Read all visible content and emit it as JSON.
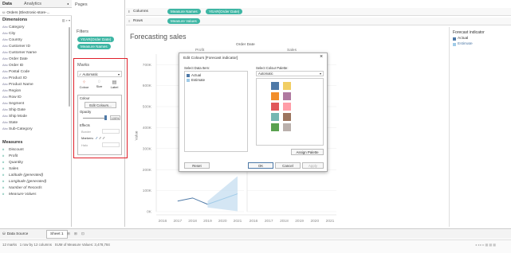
{
  "left_tabs": {
    "data": "Data",
    "analytics": "Analytics"
  },
  "datasource": "Orders (Electronic-store-...",
  "dimensions": {
    "title": "Dimensions",
    "fields": [
      "Category",
      "City",
      "Country",
      "Customer ID",
      "Customer Name",
      "Order Date",
      "Order ID",
      "Postal Code",
      "Product ID",
      "Product Name",
      "Region",
      "Row ID",
      "Segment",
      "Ship Date",
      "Ship Mode",
      "State",
      "Sub-Category"
    ]
  },
  "measures": {
    "title": "Measures",
    "fields": [
      "Discount",
      "Profit",
      "Quantity",
      "Sales",
      "Latitude (generated)",
      "Longitude (generated)",
      "Number of Records",
      "Measure Values"
    ]
  },
  "pages_label": "Pages",
  "filters": {
    "label": "Filters",
    "items": [
      "YEAR(Order Date)",
      "Measure Names"
    ]
  },
  "marks": {
    "label": "Marks",
    "type": "Automatic",
    "buttons": [
      "Colour",
      "Size",
      "Label"
    ],
    "colour_section": "Colour",
    "edit_colours": "Edit Colours...",
    "opacity_label": "Opacity",
    "opacity_value": "100%",
    "effects_label": "Effects",
    "border_label": "Border",
    "markers_label": "Markers:",
    "halo_label": "Halo"
  },
  "shelves": {
    "columns_label": "Columns",
    "columns": [
      "Measure Names",
      "YEAR(Order Date)"
    ],
    "rows_label": "Rows",
    "rows": [
      "Measure Values"
    ]
  },
  "chart": {
    "title": "Forecasting sales",
    "header": "Order Date",
    "panel_labels": [
      "Profit",
      "Sales"
    ],
    "ylabel": "Value",
    "yticks": [
      "700K",
      "600K",
      "500K",
      "400K",
      "300K",
      "200K",
      "100K",
      "0K"
    ],
    "xticks": [
      "2016",
      "2017",
      "2018",
      "2019",
      "2020",
      "2021"
    ]
  },
  "chart_data": {
    "type": "line",
    "title": "Forecasting sales",
    "xlabel": "Order Date",
    "ylabel": "Value",
    "ylim": [
      0,
      750000
    ],
    "panels": [
      {
        "name": "Profit",
        "x": [
          "2016",
          "2017",
          "2018",
          "2019",
          "2020",
          "2021"
        ],
        "series": [
          {
            "name": "Actual",
            "values": [
              null,
              50000,
              65000,
              35000,
              null,
              null
            ]
          },
          {
            "name": "Estimate",
            "values": [
              null,
              null,
              null,
              35000,
              60000,
              85000
            ]
          }
        ]
      },
      {
        "name": "Sales",
        "x": [
          "2016",
          "2017",
          "2018",
          "2019",
          "2020",
          "2021"
        ],
        "series": []
      }
    ]
  },
  "legend": {
    "title": "Forecast indicator",
    "items": [
      "Actual",
      "Estimate"
    ],
    "colors": [
      "#4e79a7",
      "#a0cbe8"
    ]
  },
  "dialog": {
    "title": "Edit Colours [Forecast indicator]",
    "select_label": "Select Data Item:",
    "items": [
      "Actual",
      "Estimate"
    ],
    "palette_label": "Select Colour Palette:",
    "palette_value": "Automatic",
    "swatches": [
      "#4e79a7",
      "#f1ce63",
      "#f28e2b",
      "#b07aa1",
      "#e15759",
      "#ff9da7",
      "#76b7b2",
      "#9c755f",
      "#59a14f",
      "#bab0ac"
    ],
    "assign": "Assign Palette",
    "reset": "Reset",
    "ok": "OK",
    "cancel": "Cancel",
    "apply": "Apply",
    "close": "×"
  },
  "bottom_tabs": [
    "Data Source",
    "Sheet 1"
  ],
  "status": "12 marks   1 row by 12 columns   SUM of Measure Values: 3,478,784"
}
